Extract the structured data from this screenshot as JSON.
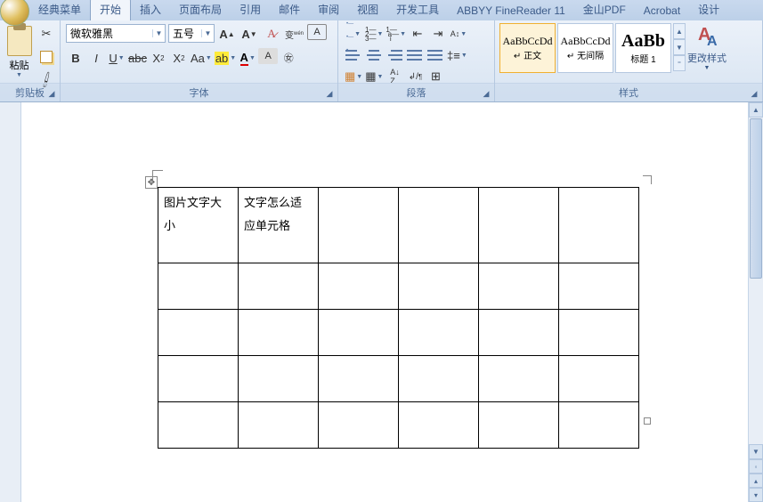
{
  "tabs": {
    "classic": "经典菜单",
    "home": "开始",
    "insert": "插入",
    "layout": "页面布局",
    "ref": "引用",
    "mail": "邮件",
    "review": "审阅",
    "view": "视图",
    "dev": "开发工具",
    "abbyy": "ABBYY FineReader 11",
    "pdf": "金山PDF",
    "acrobat": "Acrobat",
    "design": "设计"
  },
  "clipboard": {
    "paste": "粘贴",
    "title": "剪贴板"
  },
  "font": {
    "family": "微软雅黑",
    "size": "五号",
    "title": "字体"
  },
  "paragraph": {
    "title": "段落"
  },
  "styles": {
    "title": "样式",
    "s1_preview": "AaBbCcDd",
    "s1_name": "↵ 正文",
    "s2_preview": "AaBbCcDd",
    "s2_name": "↵ 无间隔",
    "s3_preview": "AaBb",
    "s3_name": "标题 1",
    "change": "更改样式"
  },
  "table": {
    "r1c1": "图片文字大小",
    "r1c2": "文字怎么适应单元格"
  }
}
